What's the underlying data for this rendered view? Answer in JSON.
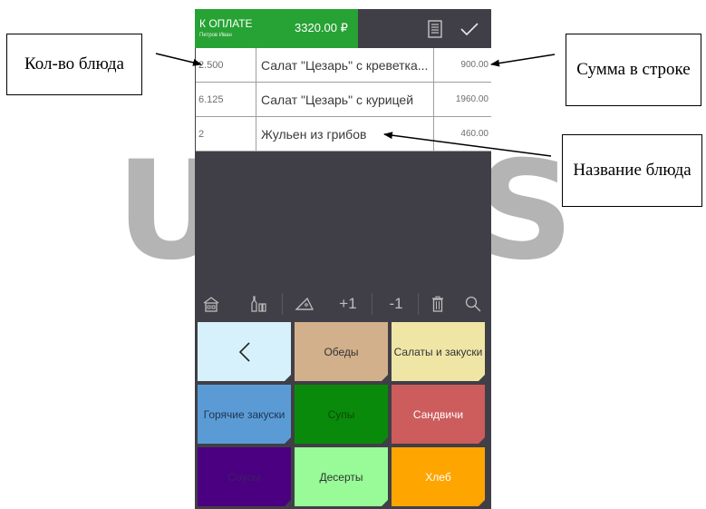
{
  "watermark": {
    "left": "U",
    "right": "S"
  },
  "callouts": {
    "quantity": "Кол-во блюда",
    "sum": "Сумма в строке",
    "name": "Название блюда"
  },
  "header": {
    "label": "К ОПЛАТЕ",
    "customer": "Петров Иван",
    "total": "3320.00 ₽"
  },
  "orders": [
    {
      "qty": "2.500",
      "name": "Салат \"Цезарь\" с креветка...",
      "sum": "900.00"
    },
    {
      "qty": "6.125",
      "name": "Салат \"Цезарь\" с курицей",
      "sum": "1960.00"
    },
    {
      "qty": "2",
      "name": "Жульен из грибов",
      "sum": "460.00"
    }
  ],
  "toolbar": {
    "plus": "+1",
    "minus": "-1"
  },
  "categories": [
    {
      "label": "<",
      "color": "#d6f1fb",
      "text": "#222222"
    },
    {
      "label": "Обеды",
      "color": "#d3b08c",
      "text": "#333333"
    },
    {
      "label": "Салаты и закуски",
      "color": "#efe6a6",
      "text": "#333333"
    },
    {
      "label": "Горячие закуски",
      "color": "#5b9bd5",
      "text": "#1f3550"
    },
    {
      "label": "Супы",
      "color": "#0a8a0a",
      "text": "#0a4a0a"
    },
    {
      "label": "Сандвичи",
      "color": "#cd5c5c",
      "text": "#ffffff"
    },
    {
      "label": "Соусы",
      "color": "#4b0082",
      "text": "#3a2060"
    },
    {
      "label": "Десерты",
      "color": "#98fb98",
      "text": "#333333"
    },
    {
      "label": "Хлеб",
      "color": "#ffa500",
      "text": "#ffffff"
    }
  ]
}
